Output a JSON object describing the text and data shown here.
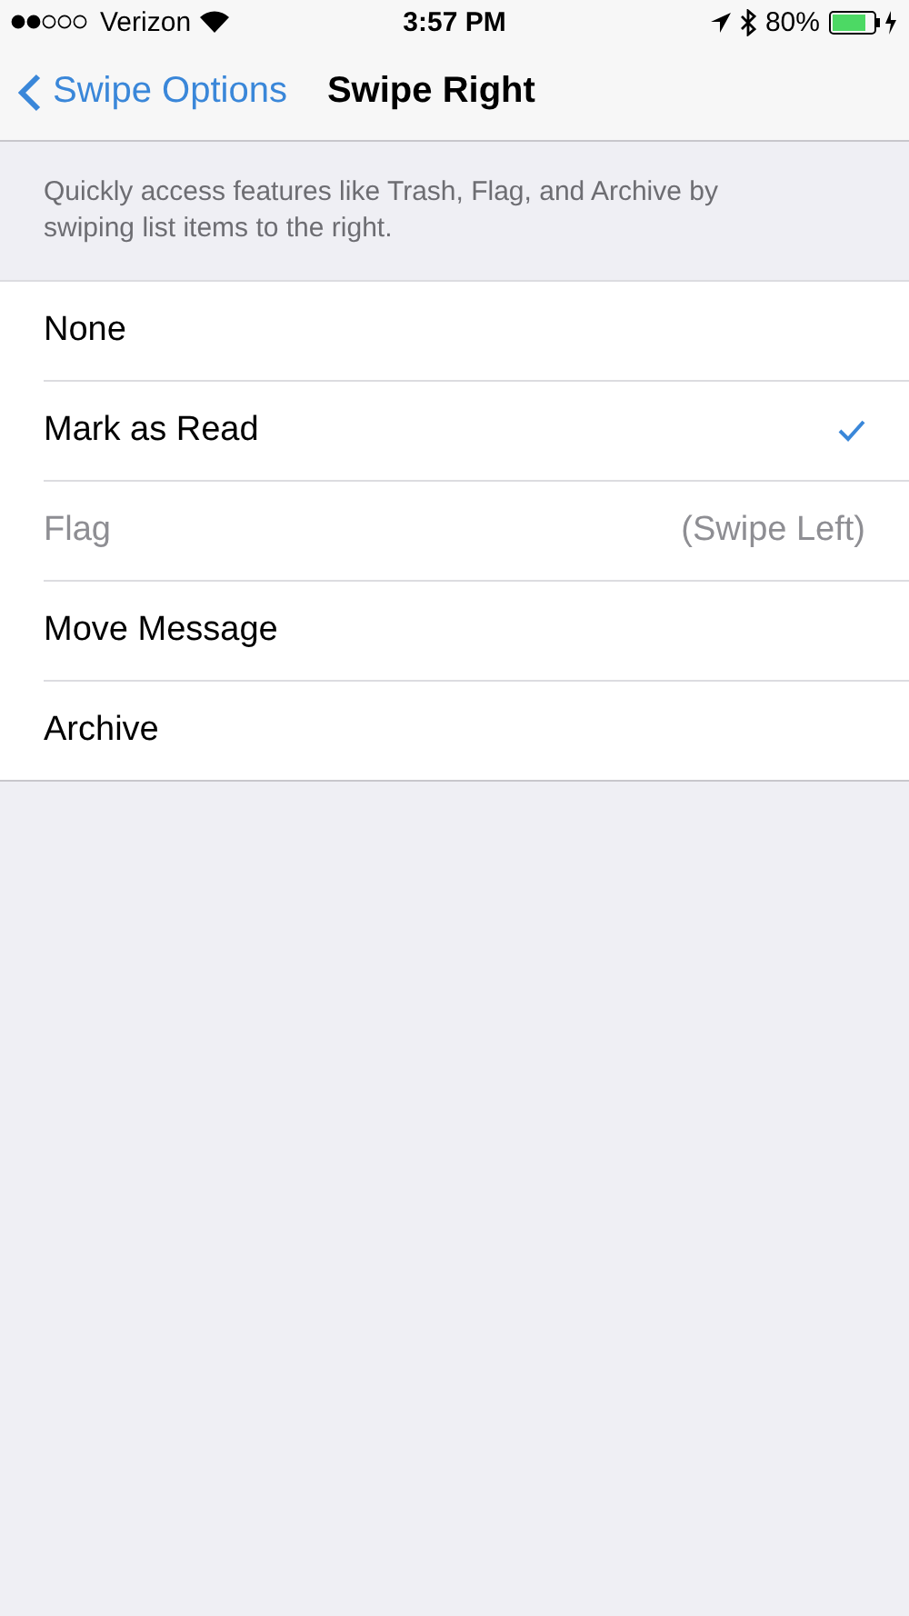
{
  "status_bar": {
    "carrier": "Verizon",
    "time": "3:57 PM",
    "battery": "80%"
  },
  "nav": {
    "back": "Swipe Options",
    "title": "Swipe Right"
  },
  "description": "Quickly access features like Trash, Flag, and Archive by swiping list items to the right.",
  "options": [
    {
      "label": "None",
      "selected": false,
      "disabled": false
    },
    {
      "label": "Mark as Read",
      "selected": true,
      "disabled": false
    },
    {
      "label": "Flag",
      "selected": false,
      "disabled": true,
      "detail": "(Swipe Left)"
    },
    {
      "label": "Move Message",
      "selected": false,
      "disabled": false
    },
    {
      "label": "Archive",
      "selected": false,
      "disabled": false
    }
  ]
}
